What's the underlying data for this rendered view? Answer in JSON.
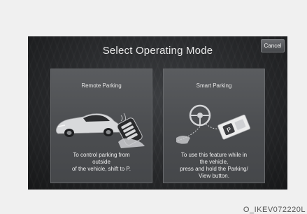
{
  "title": "Select Operating Mode",
  "cancel_label": "Cancel",
  "options": [
    {
      "label": "Remote Parking",
      "description_lines": [
        "To control parking from",
        "outside",
        "of the vehicle, shift to P."
      ],
      "icon": "car-with-remote-key-icon"
    },
    {
      "label": "Smart Parking",
      "description_lines": [
        "To use this feature while in",
        "the vehicle,",
        "press and hold the Parking/",
        "View button."
      ],
      "icon": "steering-wheel-with-parking-button-icon"
    }
  ],
  "image_code": "O_IKEV072220L"
}
